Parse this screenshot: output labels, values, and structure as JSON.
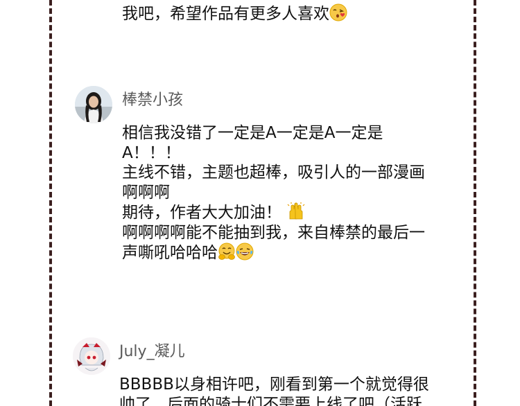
{
  "top_comment": {
    "partial_line": "我吧，希望作品有更多人喜欢",
    "line": "我吧，希望作品有更多人喜欢",
    "emoji": "kissing-face-icon"
  },
  "comments": [
    {
      "username": "棒禁小孩",
      "avatar": "girl-photo-avatar",
      "lines": [
        "相信我没错了一定是A一定是A一定是",
        "A！！！",
        "主线不错，主题也超棒，吸引人的一部漫画",
        "啊啊啊",
        "期待，作者大大加油！",
        "啊啊啊啊能不能抽到我，来自棒禁的最后一",
        "声嘶吼哈哈哈"
      ],
      "emojis": [
        "raising-hands-icon",
        "hugging-face-icon",
        "laughing-tears-icon"
      ]
    },
    {
      "username": "July_凝儿",
      "avatar": "anime-girl-avatar",
      "lines": [
        "BBBBB以身相许吧，刚看到第一个就觉得很",
        "帅了，后面的骑士们不需要上线了吧（活跃"
      ]
    }
  ]
}
